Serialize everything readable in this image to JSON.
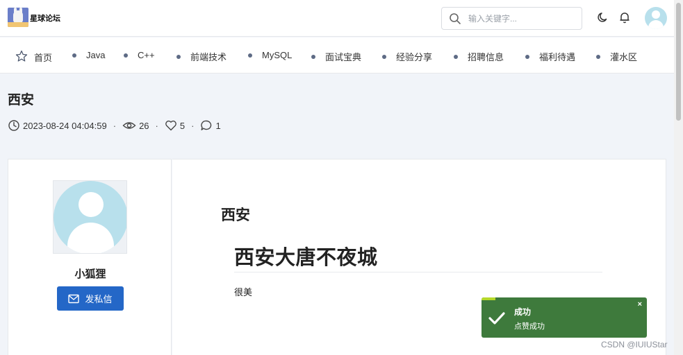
{
  "header": {
    "site_name": "星球论坛",
    "search_placeholder": "输入关键字..."
  },
  "nav": {
    "items": [
      {
        "label": "首页"
      },
      {
        "label": "Java"
      },
      {
        "label": "C++"
      },
      {
        "label": "前端技术"
      },
      {
        "label": "MySQL"
      },
      {
        "label": "面试宝典"
      },
      {
        "label": "经验分享"
      },
      {
        "label": "招聘信息"
      },
      {
        "label": "福利待遇"
      },
      {
        "label": "灌水区"
      }
    ]
  },
  "post": {
    "title": "西安",
    "date": "2023-08-24 04:04:59",
    "views": "26",
    "likes": "5",
    "comments": "1",
    "sep": "·",
    "content_title": "西安",
    "content_heading": "西安大唐不夜城",
    "content_text": "很美"
  },
  "author": {
    "name": "小狐狸",
    "pm_label": "发私信"
  },
  "toast": {
    "title": "成功",
    "message": "点赞成功",
    "close": "×"
  },
  "watermark": "CSDN @IUIUStar",
  "colors": {
    "primary": "#2467c7",
    "toast_bg": "#3e7a3c",
    "page_bg": "#f1f4f9",
    "avatar": "#b8e0ec"
  }
}
